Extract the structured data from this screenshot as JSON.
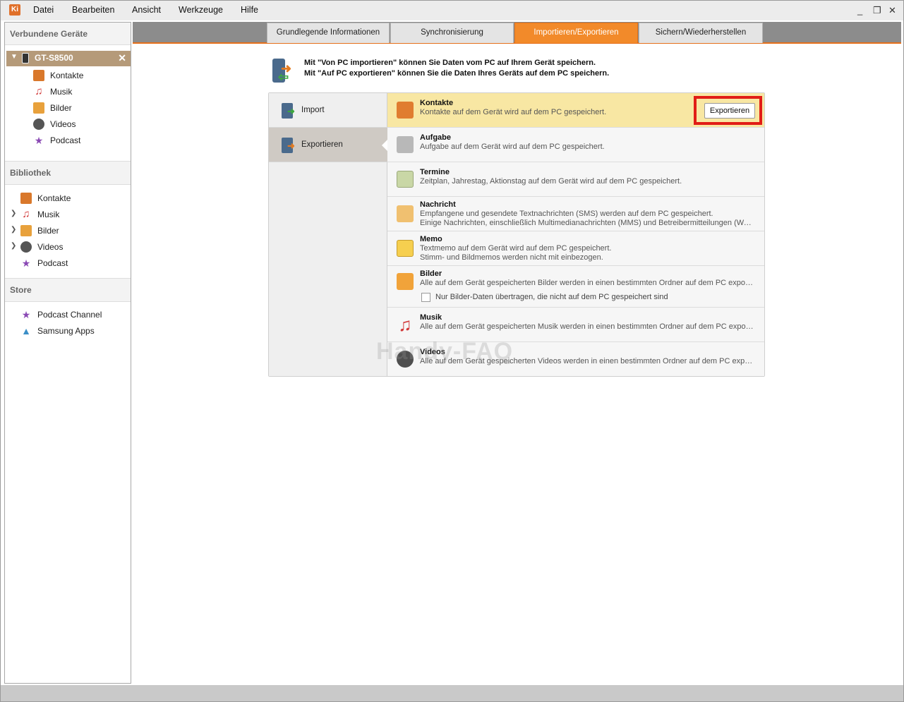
{
  "app": {
    "logo": "Ki"
  },
  "menu": [
    "Datei",
    "Bearbeiten",
    "Ansicht",
    "Werkzeuge",
    "Hilfe"
  ],
  "window_controls": {
    "minimize": "_",
    "restore": "❐",
    "close": "✕"
  },
  "sidebar": {
    "header": "Verbundene Geräte",
    "device": {
      "name": "GT-S8500"
    },
    "device_items": [
      {
        "label": "Kontakte",
        "icon": "contacts-icon"
      },
      {
        "label": "Musik",
        "icon": "music-icon"
      },
      {
        "label": "Bilder",
        "icon": "pictures-icon"
      },
      {
        "label": "Videos",
        "icon": "videos-icon"
      },
      {
        "label": "Podcast",
        "icon": "podcast-icon"
      }
    ],
    "library_header": "Bibliothek",
    "library_items": [
      {
        "label": "Kontakte",
        "icon": "contacts-icon",
        "expandable": false
      },
      {
        "label": "Musik",
        "icon": "music-icon",
        "expandable": true
      },
      {
        "label": "Bilder",
        "icon": "pictures-icon",
        "expandable": true
      },
      {
        "label": "Videos",
        "icon": "videos-icon",
        "expandable": true
      },
      {
        "label": "Podcast",
        "icon": "podcast-icon",
        "expandable": false
      }
    ],
    "store_header": "Store",
    "store_items": [
      {
        "label": "Podcast Channel",
        "icon": "podcast-icon"
      },
      {
        "label": "Samsung Apps",
        "icon": "apps-icon"
      }
    ]
  },
  "tabs": [
    {
      "label": "Grundlegende Informationen",
      "active": false
    },
    {
      "label": "Synchronisierung",
      "active": false
    },
    {
      "label": "Importieren/Exportieren",
      "active": true
    },
    {
      "label": "Sichern/Wiederherstellen",
      "active": false
    }
  ],
  "info": {
    "line1": "Mit \"Von PC importieren\" können Sie Daten vom PC auf Ihrem Gerät speichern.",
    "line2": "Mit \"Auf PC exportieren\" können Sie die Daten Ihres Geräts auf dem PC speichern."
  },
  "side_tabs": [
    {
      "label": "Import",
      "active": false
    },
    {
      "label": "Exportieren",
      "active": true
    }
  ],
  "rows": [
    {
      "title": "Kontakte",
      "desc": [
        "Kontakte auf dem Gerät wird auf dem PC gespeichert."
      ],
      "icon": "contacts-icon",
      "selected": true
    },
    {
      "title": "Aufgabe",
      "desc": [
        "Aufgabe auf dem Gerät wird auf dem PC gespeichert."
      ],
      "icon": "task-icon"
    },
    {
      "title": "Termine",
      "desc": [
        "Zeitplan, Jahrestag, Aktionstag auf dem Gerät wird auf dem PC gespeichert."
      ],
      "icon": "calendar-icon"
    },
    {
      "title": "Nachricht",
      "desc": [
        "Empfangene und gesendete Textnachrichten (SMS) werden auf dem PC gespeichert.",
        "Einige Nachrichten, einschließlich Multimedianachrichten (MMS) und Betreibermitteilungen (WAP-Push)"
      ],
      "icon": "message-icon"
    },
    {
      "title": "Memo",
      "desc": [
        "Textmemo auf dem Gerät wird auf dem PC gespeichert.",
        "Stimm- und Bildmemos werden nicht mit einbezogen."
      ],
      "icon": "memo-icon"
    },
    {
      "title": "Bilder",
      "desc": [
        "Alle auf dem Gerät gespeicherten Bilder werden in einen bestimmten Ordner auf dem PC exportiert."
      ],
      "icon": "pictures-icon"
    },
    {
      "title": "Musik",
      "desc": [
        "Alle auf dem Gerät gespeicherten Musik werden in einen bestimmten Ordner auf dem PC exportiert."
      ],
      "icon": "music-icon"
    },
    {
      "title": "Videos",
      "desc": [
        "Alle auf dem Gerät gespeicherten Videos werden in einen bestimmten Ordner auf dem PC exportiert."
      ],
      "icon": "videos-icon"
    }
  ],
  "export_button": "Exportieren",
  "pictures_checkbox": {
    "label": "Nur Bilder-Daten übertragen, die nicht auf dem PC gespeichert sind",
    "checked": false
  },
  "watermark": "Handy-FAQ",
  "colors": {
    "accent": "#f28a2a",
    "device_header": "#b59a79",
    "selected_row": "#f8e7a3",
    "highlight": "#e11d16"
  }
}
